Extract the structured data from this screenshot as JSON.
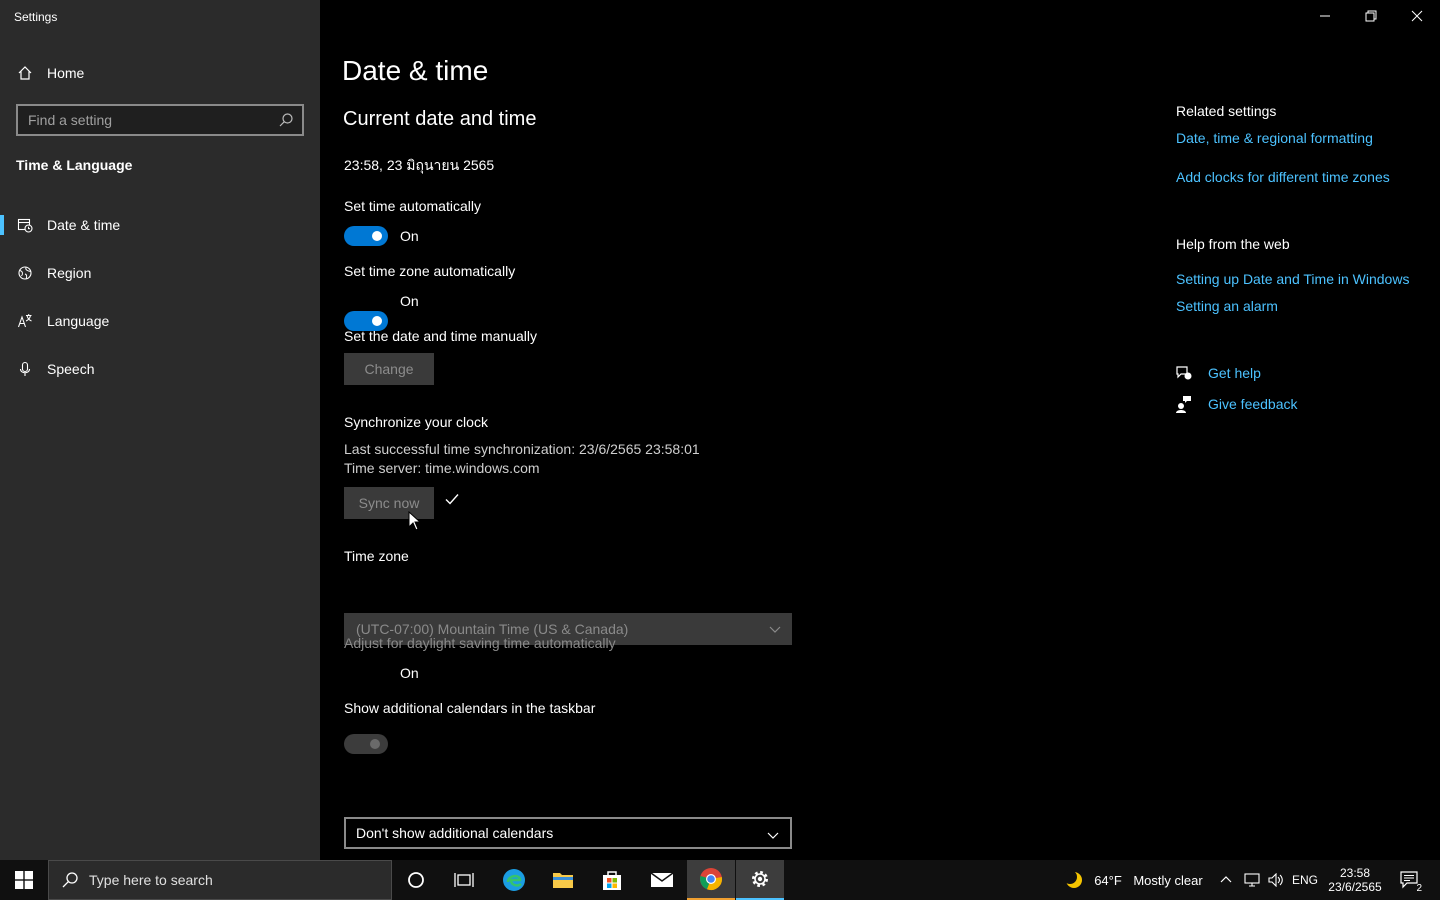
{
  "window": {
    "app_title": "Settings"
  },
  "sidebar": {
    "home_label": "Home",
    "search_placeholder": "Find a setting",
    "section_title": "Time & Language",
    "items": [
      {
        "label": "Date & time",
        "icon": "calendar-clock-icon"
      },
      {
        "label": "Region",
        "icon": "globe-icon"
      },
      {
        "label": "Language",
        "icon": "language-icon"
      },
      {
        "label": "Speech",
        "icon": "microphone-icon"
      }
    ]
  },
  "main": {
    "page_title": "Date & time",
    "subtitle": "Current date and time",
    "current_datetime": "23:58, 23 มิถุนายน 2565",
    "set_time_auto": {
      "label": "Set time automatically",
      "state": "On"
    },
    "set_tz_auto": {
      "label": "Set time zone automatically",
      "state": "On"
    },
    "manual": {
      "label": "Set the date and time manually",
      "button": "Change"
    },
    "sync": {
      "label": "Synchronize your clock",
      "last_sync": "Last successful time synchronization: 23/6/2565 23:58:01",
      "server": "Time server: time.windows.com",
      "button": "Sync now"
    },
    "timezone": {
      "label": "Time zone",
      "value": "(UTC-07:00) Mountain Time (US & Canada)"
    },
    "daylight": {
      "label": "Adjust for daylight saving time automatically",
      "state": "On"
    },
    "calendars": {
      "label": "Show additional calendars in the taskbar",
      "value": "Don't show additional calendars"
    }
  },
  "related": {
    "heading": "Related settings",
    "links": [
      "Date, time & regional formatting",
      "Add clocks for different time zones"
    ],
    "help_heading": "Help from the web",
    "help_links": [
      "Setting up Date and Time in Windows",
      "Setting an alarm"
    ],
    "get_help": "Get help",
    "give_feedback": "Give feedback"
  },
  "taskbar": {
    "search_placeholder": "Type here to search",
    "weather_temp": "64°F",
    "weather_text": "Mostly clear",
    "lang": "ENG",
    "time": "23:58",
    "date": "23/6/2565",
    "notification_count": "2"
  },
  "colors": {
    "accent": "#0078d4",
    "link": "#4cc2ff",
    "sidebar_bg": "#2b2b2b"
  }
}
